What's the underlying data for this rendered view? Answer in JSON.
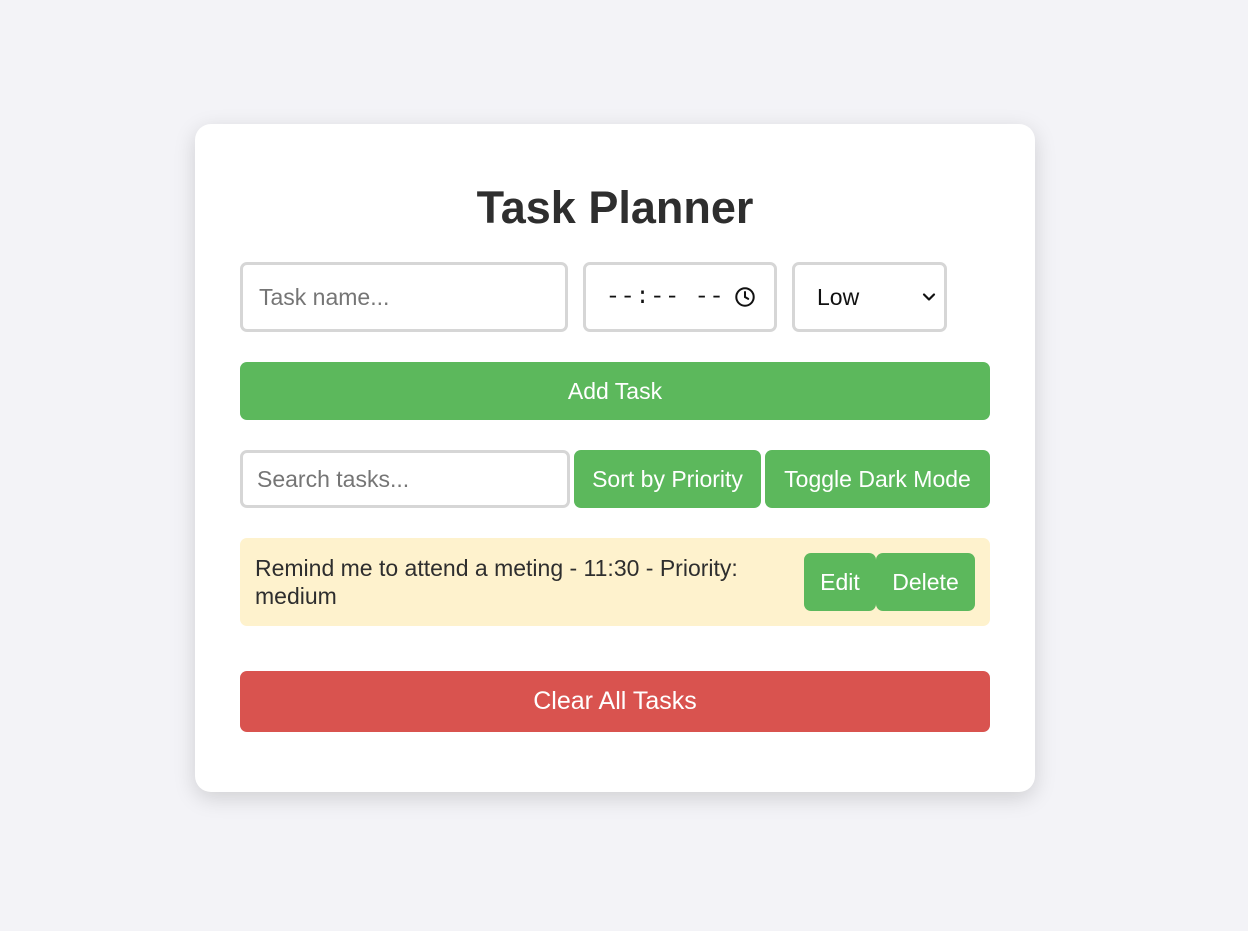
{
  "app": {
    "title": "Task Planner"
  },
  "form": {
    "task_name": {
      "value": "",
      "placeholder": "Task name..."
    },
    "time": {
      "display": "--:-- --",
      "icon": "clock-icon"
    },
    "priority": {
      "selected": "Low",
      "icon": "chevron-down-icon"
    },
    "add_label": "Add Task"
  },
  "toolbar": {
    "search": {
      "value": "",
      "placeholder": "Search tasks..."
    },
    "sort_label": "Sort by Priority",
    "dark_mode_label": "Toggle Dark Mode"
  },
  "tasks": [
    {
      "text": "Remind me to attend a meting - 11:30 - Priority: medium",
      "edit_label": "Edit",
      "delete_label": "Delete"
    }
  ],
  "footer": {
    "clear_label": "Clear All Tasks"
  },
  "colors": {
    "background": "#f3f3f7",
    "card": "#ffffff",
    "primary_button": "#5cb85c",
    "danger_button": "#d9534f",
    "task_item_medium": "#fef2cd",
    "input_border": "#d6d6d6"
  }
}
